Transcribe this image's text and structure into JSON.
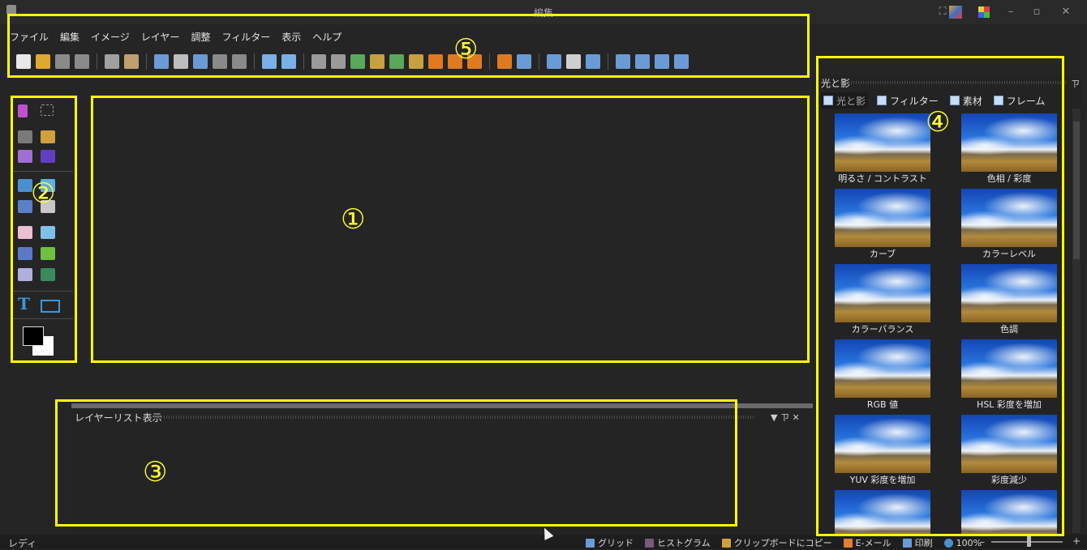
{
  "window": {
    "title": "編集",
    "controls": [
      "⛶",
      "–",
      "▫",
      "✕"
    ]
  },
  "menu": [
    "ファイル",
    "編集",
    "イメージ",
    "レイヤー",
    "調整",
    "フィルター",
    "表示",
    "ヘルプ"
  ],
  "toolbar_icon_colors": [
    "#e8e8e8",
    "#e0a830",
    "#8a8a8a",
    "#8a8a8a",
    "#a0a0a0",
    "#c0a070",
    "#6b9bd6",
    "#bdbdbd",
    "#6b9bd6",
    "#8a8a8a",
    "#8a8a8a",
    "#7ab0e8",
    "#7ab0e8",
    "#9a9a9a",
    "#9a9a9a",
    "#5aa85a",
    "#c8a040",
    "#5aa85a",
    "#c8a040",
    "#e07a20",
    "#e07a20",
    "#e07a20",
    "#e07a20",
    "#6b9bd6",
    "#6b9bd6",
    "#cfcfcf",
    "#6b9bd6",
    "#6b9bd6",
    "#6b9bd6",
    "#6b9bd6",
    "#6b9bd6",
    "#6b9bd6"
  ],
  "markers": {
    "canvas": "①",
    "tools": "②",
    "layers": "③",
    "adjust": "④",
    "menu": "⑤"
  },
  "layers_panel": {
    "title": "レイヤーリスト表示",
    "controls": "▼ ㄗ ✕"
  },
  "adjust_panel": {
    "title": "光と影",
    "pin": "ㄗ",
    "tabs": [
      "光と影",
      "フィルター",
      "素材",
      "フレーム"
    ],
    "items": [
      "明るさ / コントラスト",
      "色相 / 彩度",
      "カーブ",
      "カラーレベル",
      "カラーバランス",
      "色調",
      "RGB 値",
      "HSL 彩度を増加",
      "YUV 彩度を増加",
      "彩度減少",
      "",
      ""
    ]
  },
  "status": {
    "left": "レディ",
    "grid": "グリッド",
    "histogram": "ヒストグラム",
    "clipboard": "クリップボードにコピー",
    "email": "E-メール",
    "print": "印刷",
    "zoom": "100%"
  },
  "colors": {
    "annotation": "#ffff00",
    "background": "#252526",
    "foreground_swatch": "#000000",
    "background_swatch": "#ffffff"
  }
}
